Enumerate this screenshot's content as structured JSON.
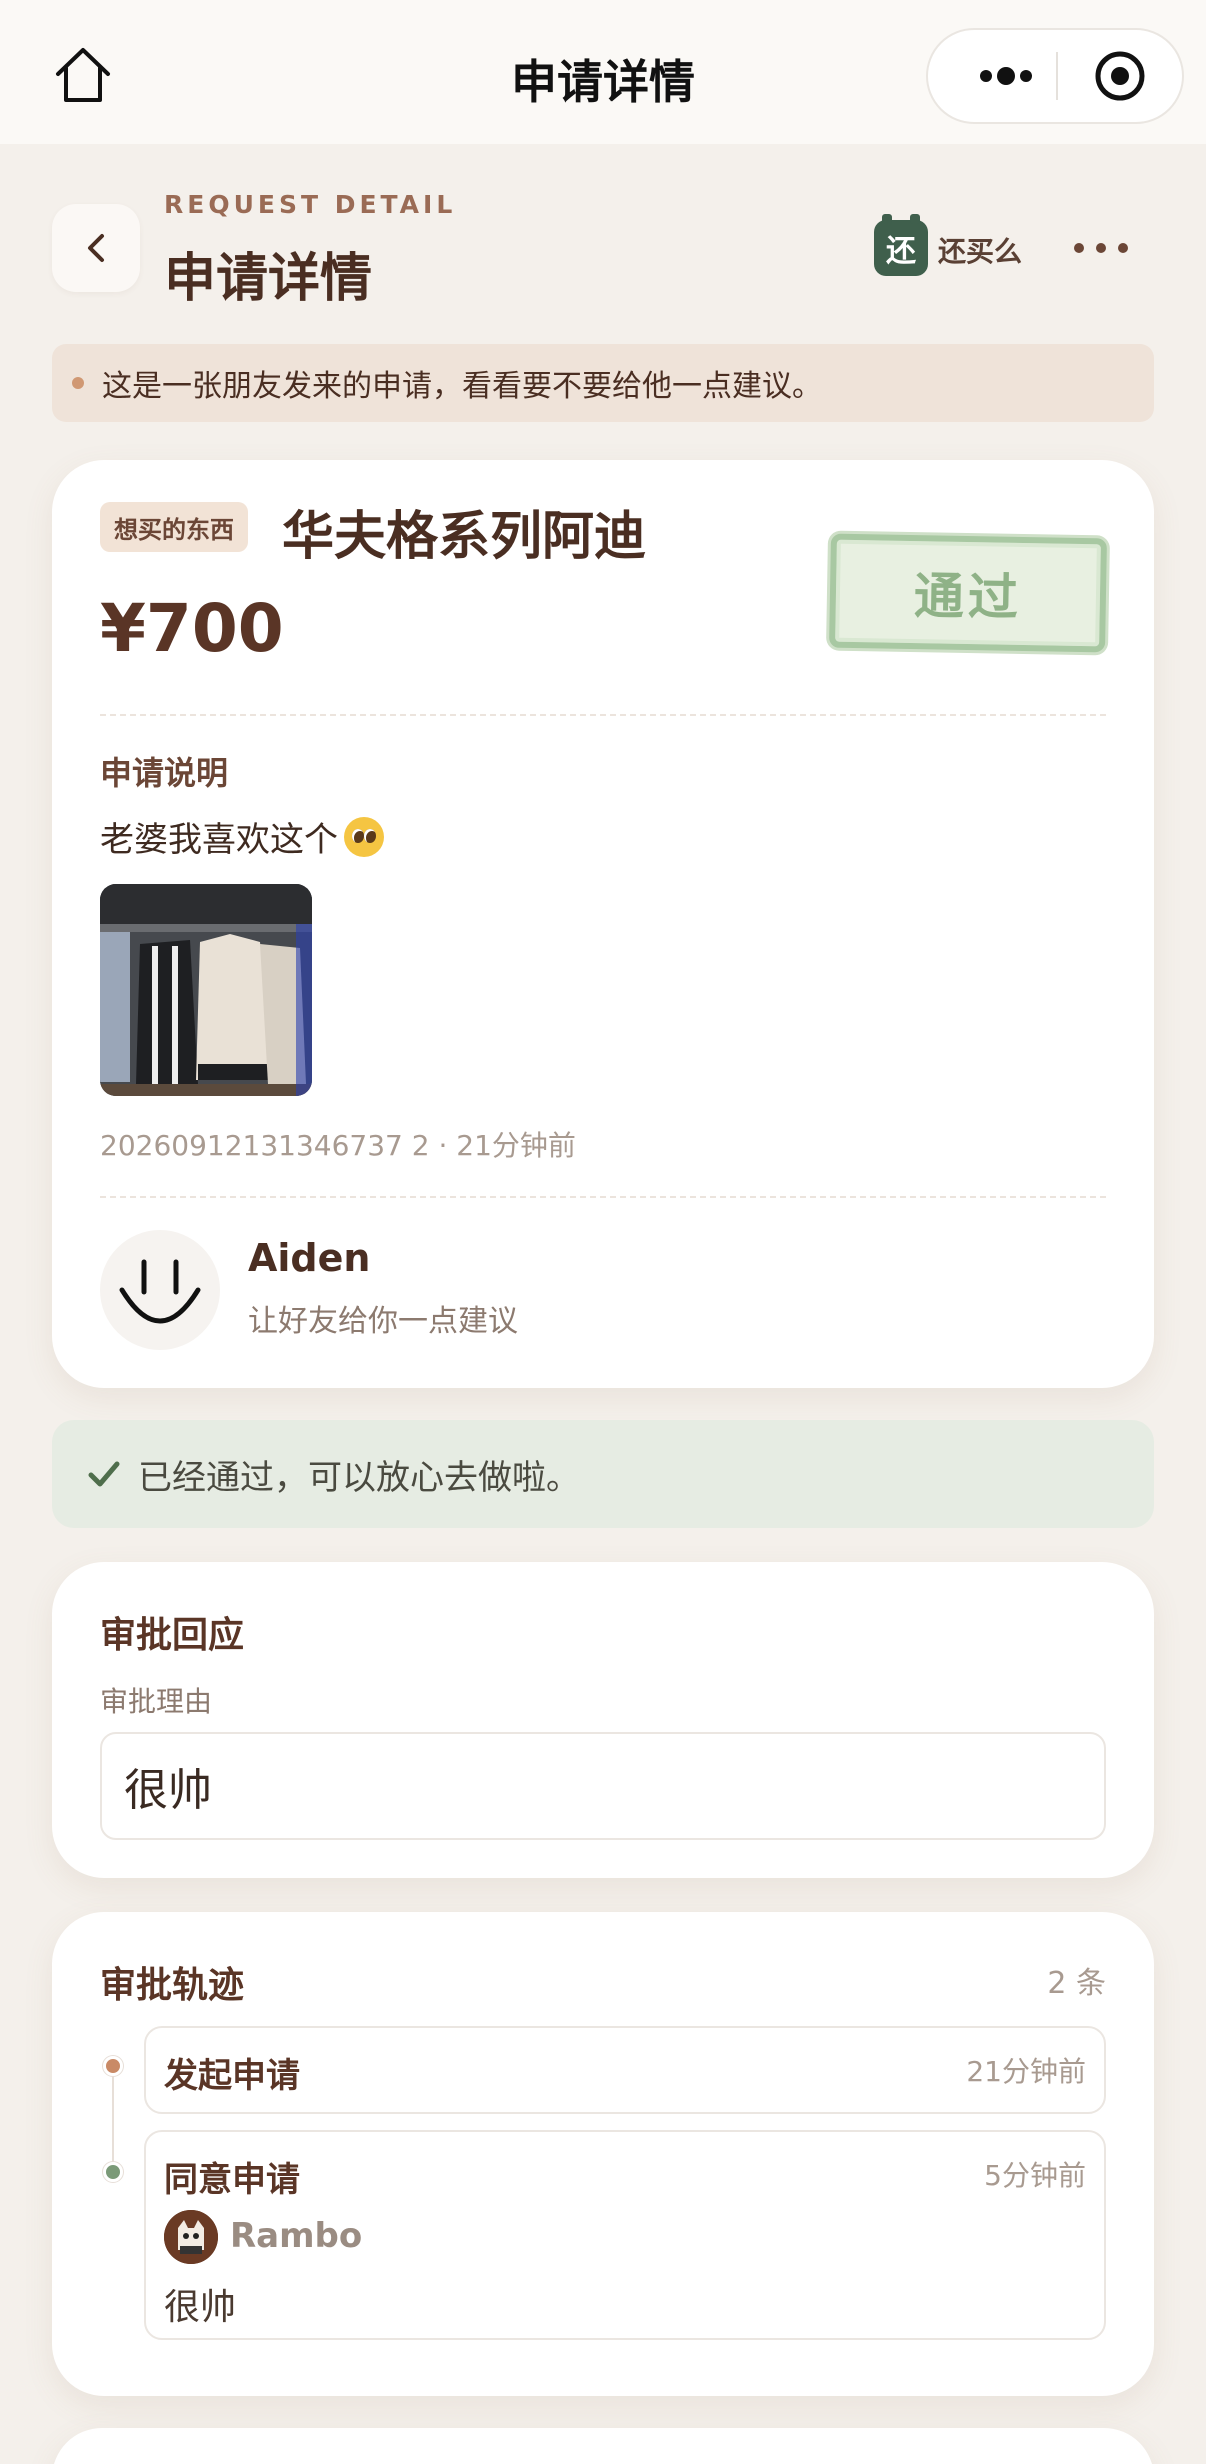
{
  "navbar": {
    "title": "申请详情",
    "icons": {
      "home": "home-icon",
      "more": "more-dots-icon",
      "close": "target-icon"
    }
  },
  "header": {
    "kicker": "REQUEST DETAIL",
    "title": "申请详情",
    "brand_logo": "还",
    "brand_name": "还买么"
  },
  "notice": {
    "text": "这是一张朋友发来的申请，看看要不要给他一点建议。"
  },
  "request": {
    "tag": "想买的东西",
    "item_name": "华夫格系列阿迪",
    "price": "¥700",
    "stamp": "通过",
    "desc_label": "申请说明",
    "desc_text": "老婆我喜欢这个",
    "meta": "20260912131346737 2 · 21分钟前",
    "meta_id": "20260912131346737 2",
    "user_name": "Aiden",
    "user_sub": "让好友给你一点建议"
  },
  "status": {
    "text": "已经通过，可以放心去做啦。",
    "color": "#4f6e4c"
  },
  "response": {
    "title": "审批回应",
    "reason_label": "审批理由",
    "reason_value": "很帅"
  },
  "trail": {
    "title": "审批轨迹",
    "count": "2 条",
    "items": [
      {
        "title": "发起申请",
        "time": "21分钟前",
        "dot_color": "#c98a66"
      },
      {
        "title": "同意申请",
        "time": "5分钟前",
        "approver": "Rambo",
        "comment": "很帅",
        "dot_color": "#7b9a78"
      }
    ]
  },
  "colors": {
    "accent": "#5a3526",
    "background": "#f4f0eb",
    "notice_bg": "#efe3d9",
    "success_bg": "#e6ece3"
  }
}
